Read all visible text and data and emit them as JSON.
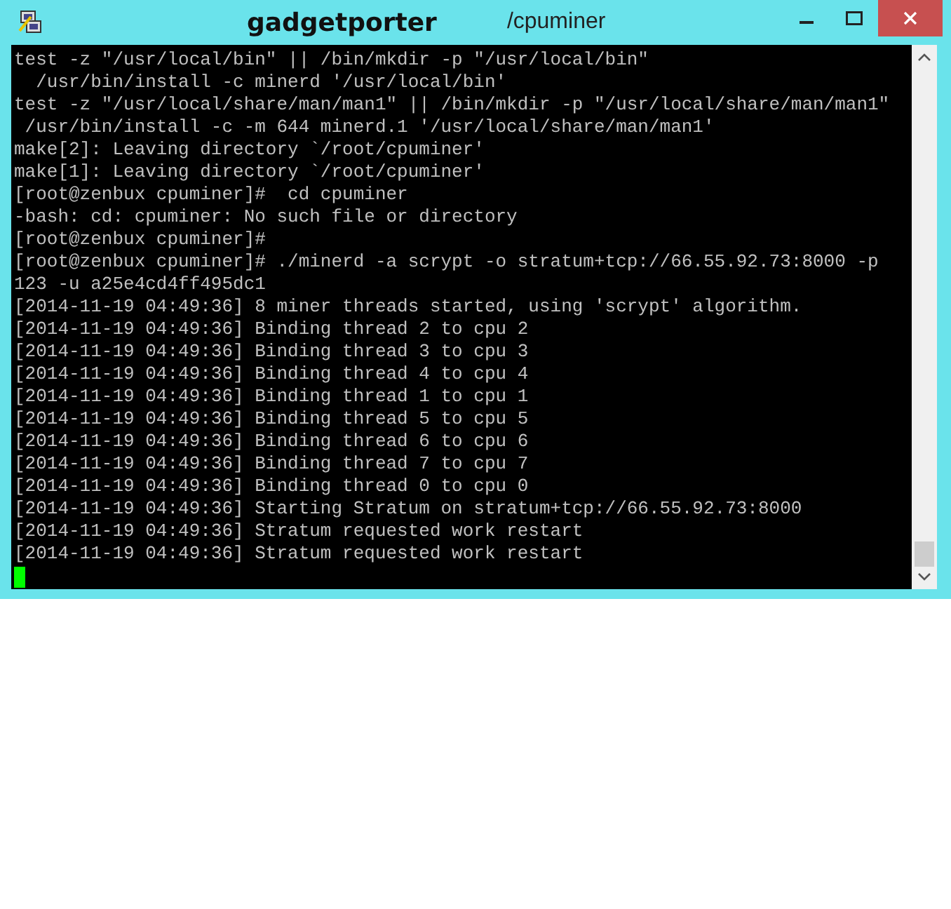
{
  "window": {
    "title": "gadgetporter",
    "path": "/cpuminer"
  },
  "terminal": {
    "lines": [
      "test -z \"/usr/local/bin\" || /bin/mkdir -p \"/usr/local/bin\"",
      "  /usr/bin/install -c minerd '/usr/local/bin'",
      "test -z \"/usr/local/share/man/man1\" || /bin/mkdir -p \"/usr/local/share/man/man1\"",
      " /usr/bin/install -c -m 644 minerd.1 '/usr/local/share/man/man1'",
      "make[2]: Leaving directory `/root/cpuminer'",
      "make[1]: Leaving directory `/root/cpuminer'",
      "[root@zenbux cpuminer]#  cd cpuminer",
      "-bash: cd: cpuminer: No such file or directory",
      "[root@zenbux cpuminer]#",
      "[root@zenbux cpuminer]# ./minerd -a scrypt -o stratum+tcp://66.55.92.73:8000 -p",
      "123 -u a25e4cd4ff495dc1",
      "[2014-11-19 04:49:36] 8 miner threads started, using 'scrypt' algorithm.",
      "[2014-11-19 04:49:36] Binding thread 2 to cpu 2",
      "[2014-11-19 04:49:36] Binding thread 3 to cpu 3",
      "[2014-11-19 04:49:36] Binding thread 4 to cpu 4",
      "[2014-11-19 04:49:36] Binding thread 1 to cpu 1",
      "[2014-11-19 04:49:36] Binding thread 5 to cpu 5",
      "[2014-11-19 04:49:36] Binding thread 6 to cpu 6",
      "[2014-11-19 04:49:36] Binding thread 7 to cpu 7",
      "[2014-11-19 04:49:36] Binding thread 0 to cpu 0",
      "[2014-11-19 04:49:36] Starting Stratum on stratum+tcp://66.55.92.73:8000",
      "[2014-11-19 04:49:36] Stratum requested work restart",
      "[2014-11-19 04:49:36] Stratum requested work restart"
    ]
  }
}
